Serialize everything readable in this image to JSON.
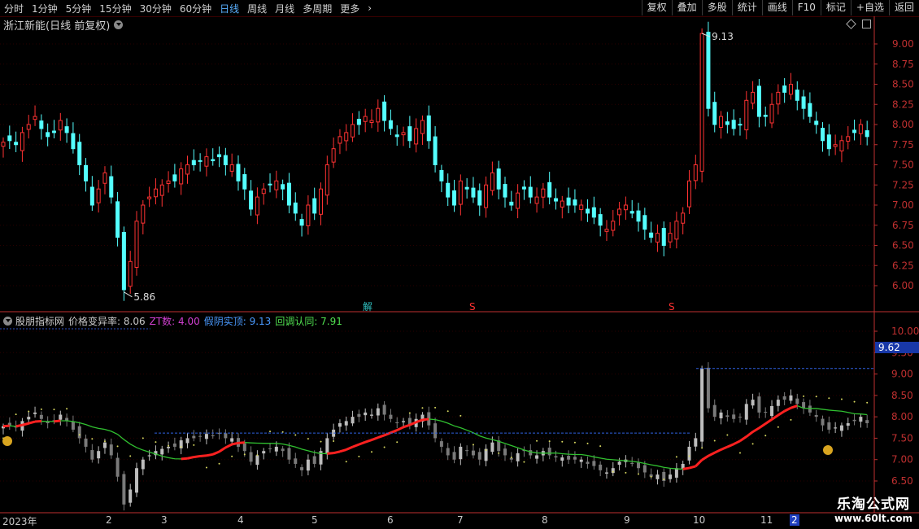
{
  "toolbar": {
    "periods": [
      "分时",
      "1分钟",
      "5分钟",
      "15分钟",
      "30分钟",
      "60分钟",
      "日线",
      "周线",
      "月线",
      "多周期",
      "更多"
    ],
    "active_period": "日线",
    "buttons": [
      "复权",
      "叠加",
      "多股",
      "统计",
      "画线",
      "F10",
      "标记",
      "+自选",
      "返回"
    ]
  },
  "main_title": "浙江新能(日线 前复权)",
  "indicator": {
    "name": "股朋指标网",
    "items": [
      {
        "label": "价格变异率:",
        "value": "8.06",
        "color": "#c8c8c8"
      },
      {
        "label": "ZT数:",
        "value": "4.00",
        "color": "#d040d0"
      },
      {
        "label": "假阴实顶:",
        "value": "9.13",
        "color": "#4a9aff"
      },
      {
        "label": "回调认同:",
        "value": "7.91",
        "color": "#50e050"
      }
    ]
  },
  "price_axis": [
    "9.00",
    "8.75",
    "8.50",
    "8.25",
    "8.00",
    "7.75",
    "7.50",
    "7.25",
    "7.00",
    "6.75",
    "6.50",
    "6.25",
    "6.00"
  ],
  "sub_axis": [
    "10.00",
    "9.50",
    "9.00",
    "8.50",
    "8.00",
    "7.50",
    "7.00",
    "6.50"
  ],
  "sub_axis_highlight": "9.62",
  "high_label": "9.13",
  "low_label": "5.86",
  "markers": [
    "解",
    "S",
    "S"
  ],
  "dates": [
    "2023年",
    "2",
    "3",
    "4",
    "5",
    "6",
    "7",
    "8",
    "9",
    "10",
    "11",
    "2"
  ],
  "colors": {
    "up": "#ff3232",
    "down": "#54ffff",
    "axis_red": "#c03030",
    "ma_green": "#30c030",
    "ma_red": "#ff2020"
  },
  "watermark": {
    "line1": "乐淘公式网",
    "line2": "www.60lt.com"
  },
  "chart_data": {
    "type": "candlestick",
    "y_axis": {
      "min": 5.86,
      "max": 9.13,
      "ticks": [
        6.0,
        6.25,
        6.5,
        6.75,
        7.0,
        7.25,
        7.5,
        7.75,
        8.0,
        8.25,
        8.5,
        8.75,
        9.0
      ]
    },
    "close_series": [
      7.78,
      7.8,
      7.75,
      7.9,
      8.0,
      8.1,
      7.95,
      7.85,
      7.9,
      8.05,
      7.9,
      7.7,
      7.5,
      7.3,
      7.0,
      7.2,
      7.4,
      7.1,
      6.6,
      5.95,
      6.3,
      6.8,
      7.0,
      7.1,
      7.2,
      7.25,
      7.3,
      7.3,
      7.45,
      7.5,
      7.5,
      7.55,
      7.6,
      7.55,
      7.6,
      7.5,
      7.5,
      7.3,
      7.2,
      6.95,
      7.1,
      7.2,
      7.25,
      7.3,
      7.2,
      7.0,
      6.9,
      6.75,
      7.0,
      6.9,
      7.2,
      7.5,
      7.7,
      7.85,
      7.9,
      8.0,
      8.0,
      8.1,
      8.05,
      8.2,
      8.05,
      7.95,
      7.85,
      7.9,
      7.8,
      7.95,
      8.05,
      7.8,
      7.5,
      7.3,
      7.1,
      7.0,
      7.3,
      7.2,
      7.1,
      7.0,
      7.25,
      7.4,
      7.2,
      7.1,
      7.0,
      7.15,
      7.2,
      7.1,
      7.1,
      7.2,
      7.1,
      7.05,
      7.05,
      7.0,
      7.0,
      7.0,
      6.9,
      6.85,
      6.75,
      6.7,
      6.8,
      6.95,
      7.0,
      6.9,
      6.8,
      6.7,
      6.6,
      6.65,
      6.5,
      6.65,
      6.8,
      6.9,
      7.3,
      7.5,
      9.13,
      8.2,
      8.0,
      8.1,
      8.0,
      7.95,
      8.0,
      8.3,
      8.4,
      8.1,
      8.1,
      8.25,
      8.4,
      8.4,
      8.5,
      8.3,
      8.2,
      8.1,
      8.0,
      7.8,
      7.7,
      7.75,
      7.8,
      7.85,
      7.9,
      8.0,
      7.85
    ],
    "annotations": {
      "max": 9.13,
      "min": 5.86
    },
    "sub_chart": {
      "y_min": 6.5,
      "y_max": 10.0,
      "highlight": 9.62
    }
  }
}
